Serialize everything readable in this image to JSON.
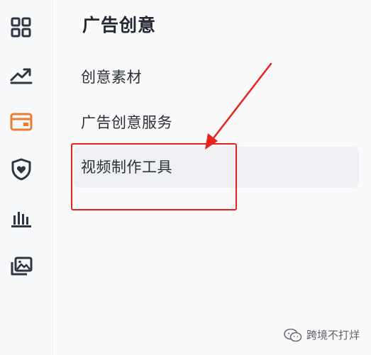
{
  "sidebar": {
    "icons": [
      {
        "name": "dashboard-grid-icon",
        "active": false
      },
      {
        "name": "trend-chart-icon",
        "active": false
      },
      {
        "name": "creative-card-icon",
        "active": true
      },
      {
        "name": "shield-heart-icon",
        "active": false
      },
      {
        "name": "bar-chart-icon",
        "active": false
      },
      {
        "name": "image-library-icon",
        "active": false
      }
    ],
    "default_color": "#2f3440",
    "active_color": "#f07b2e"
  },
  "panel": {
    "title": "广告创意",
    "items": [
      {
        "label": "创意素材",
        "active": false
      },
      {
        "label": "广告创意服务",
        "active": false
      },
      {
        "label": "视频制作工具",
        "active": true
      }
    ]
  },
  "annotation": {
    "color": "#e8231c"
  },
  "watermark": {
    "text": "跨境不打烊"
  }
}
